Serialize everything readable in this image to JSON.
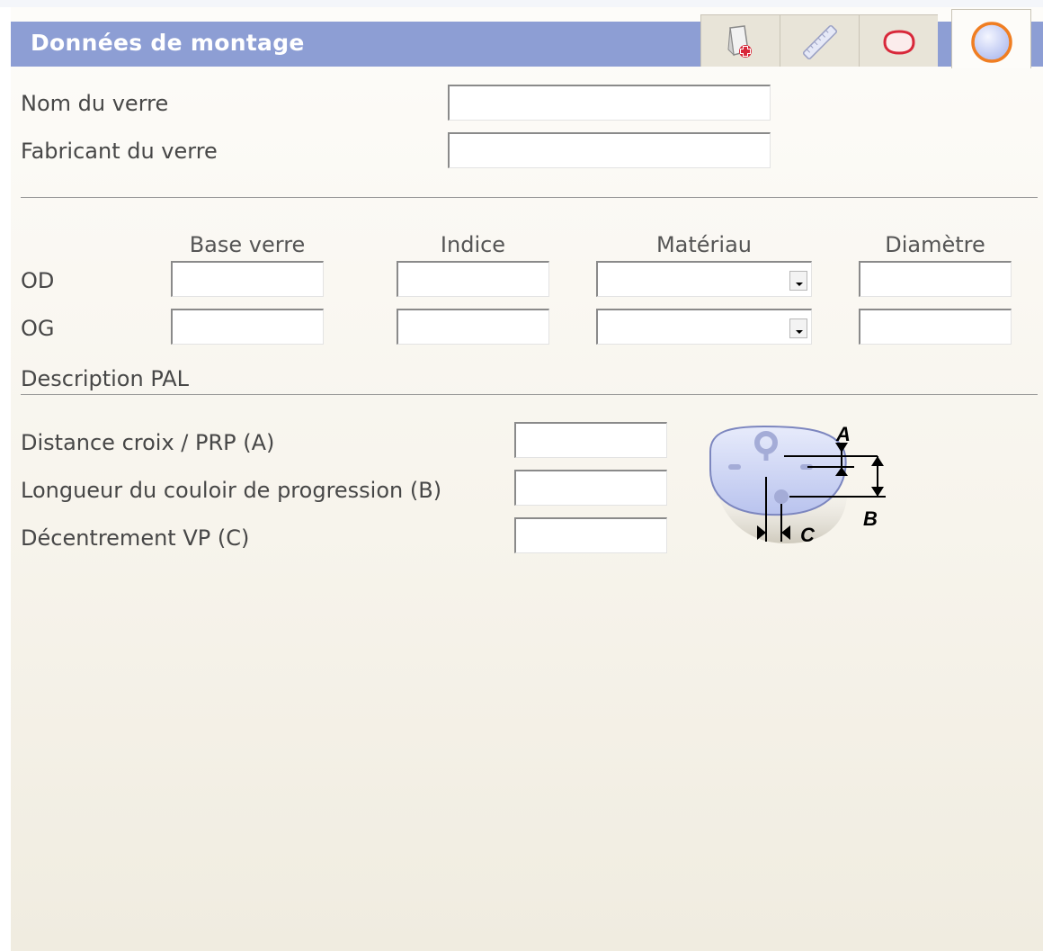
{
  "header": {
    "title": "Données de montage"
  },
  "tabs": [
    {
      "icon": "frame-add-icon"
    },
    {
      "icon": "ruler-icon"
    },
    {
      "icon": "lens-shape-icon"
    },
    {
      "icon": "lens-icon",
      "active": true
    }
  ],
  "lens_info": {
    "name_label": "Nom du verre",
    "name_value": "",
    "manufacturer_label": "Fabricant du verre",
    "manufacturer_value": ""
  },
  "lens_table": {
    "columns": [
      "Base verre",
      "Indice",
      "Matériau",
      "Diamètre"
    ],
    "rows": [
      {
        "label": "OD",
        "base": "",
        "indice": "",
        "materiau": "",
        "diametre": ""
      },
      {
        "label": "OG",
        "base": "",
        "indice": "",
        "materiau": "",
        "diametre": ""
      }
    ]
  },
  "pal": {
    "section_title": "Description PAL",
    "fields": [
      {
        "label": "Distance croix / PRP (A)",
        "value": ""
      },
      {
        "label": "Longueur du couloir de progression (B)",
        "value": ""
      },
      {
        "label": "Décentrement VP (C)",
        "value": ""
      }
    ],
    "diagram_labels": {
      "a": "A",
      "b": "B",
      "c": "C"
    }
  },
  "colors": {
    "header_bg": "#8d9ed4",
    "panel_bg": "#f7f4ec",
    "active_tab_ring": "#f07e22"
  }
}
